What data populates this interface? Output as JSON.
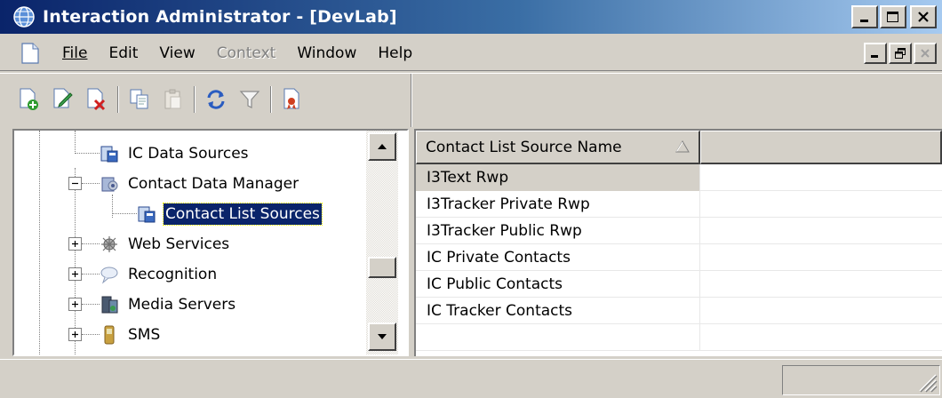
{
  "window": {
    "title": "Interaction Administrator - [DevLab]",
    "minimize": "_",
    "maximize": "□",
    "close": "✕"
  },
  "menu": {
    "items": [
      {
        "label": "File",
        "enabled": true
      },
      {
        "label": "Edit",
        "enabled": true
      },
      {
        "label": "View",
        "enabled": true
      },
      {
        "label": "Context",
        "enabled": false
      },
      {
        "label": "Window",
        "enabled": true
      },
      {
        "label": "Help",
        "enabled": true
      }
    ]
  },
  "toolbar": {
    "buttons": [
      "new-icon",
      "edit-icon",
      "delete-icon",
      "copy-icon",
      "paste-icon",
      "refresh-icon",
      "filter-icon",
      "report-icon"
    ]
  },
  "tree": {
    "items": [
      {
        "label": "IC Data Sources",
        "icon": "database-icon",
        "expander": ""
      },
      {
        "label": "Contact Data Manager",
        "icon": "contact-manager-icon",
        "expander": "−"
      },
      {
        "label": "Contact List Sources",
        "icon": "database-icon",
        "expander": "",
        "selected": true
      },
      {
        "label": "Web Services",
        "icon": "web-services-icon",
        "expander": "+"
      },
      {
        "label": "Recognition",
        "icon": "recognition-icon",
        "expander": "+"
      },
      {
        "label": "Media Servers",
        "icon": "media-server-icon",
        "expander": "+"
      },
      {
        "label": "SMS",
        "icon": "phone-icon",
        "expander": "+"
      }
    ]
  },
  "list": {
    "column_header": "Contact List Source Name",
    "rows": [
      "I3Text Rwp",
      "I3Tracker Private Rwp",
      "I3Tracker Public Rwp",
      "IC Private Contacts",
      "IC Public Contacts",
      "IC Tracker Contacts"
    ],
    "selected_index": 0
  }
}
